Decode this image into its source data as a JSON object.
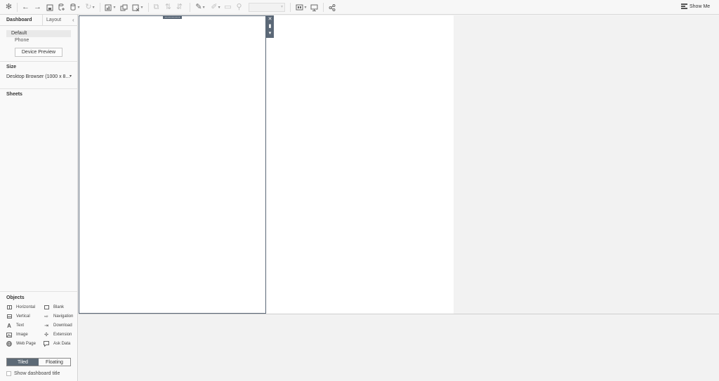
{
  "toolbar": {
    "show_me_label": "Show Me",
    "icons": [
      "tableau-logo-icon",
      "undo-icon",
      "redo-icon",
      "save-icon",
      "new-datasource-icon",
      "pause-updates-icon",
      "refresh-icon",
      "new-worksheet-icon",
      "duplicate-sheet-icon",
      "clear-sheet-icon",
      "swap-icon",
      "sort-ascending-icon",
      "sort-descending-icon",
      "highlight-icon",
      "group-icon",
      "label-icon",
      "fix-axes-icon",
      "fit-select-icon",
      "show-cards-icon",
      "presentation-mode-icon",
      "share-icon",
      "show-me-icon"
    ]
  },
  "left_pane": {
    "tabs": [
      {
        "label": "Dashboard",
        "active": true
      },
      {
        "label": "Layout",
        "active": false
      }
    ],
    "devices": {
      "default_label": "Default",
      "phone_label": "Phone",
      "preview_button": "Device Preview"
    },
    "size": {
      "title": "Size",
      "value": "Desktop Browser (1000 x 8..."
    },
    "sheets": {
      "title": "Sheets"
    },
    "objects": {
      "title": "Objects",
      "items": [
        {
          "label": "Horizontal",
          "icon": "horizontal-container-icon"
        },
        {
          "label": "Blank",
          "icon": "blank-icon"
        },
        {
          "label": "Vertical",
          "icon": "vertical-container-icon"
        },
        {
          "label": "Navigation",
          "icon": "navigation-icon"
        },
        {
          "label": "Text",
          "icon": "text-icon"
        },
        {
          "label": "Download",
          "icon": "download-icon"
        },
        {
          "label": "Image",
          "icon": "image-icon"
        },
        {
          "label": "Extension",
          "icon": "extension-icon"
        },
        {
          "label": "Web Page",
          "icon": "web-page-icon"
        },
        {
          "label": "Ask Data",
          "icon": "ask-data-icon"
        }
      ]
    },
    "mode": {
      "tiled_label": "Tiled",
      "floating_label": "Floating",
      "selected": "Tiled"
    },
    "show_title_label": "Show dashboard title",
    "show_title_checked": false
  },
  "colors": {
    "selection_accent": "#5b6877",
    "canvas_bg": "#f2f2f2",
    "page_bg": "#ffffff"
  }
}
